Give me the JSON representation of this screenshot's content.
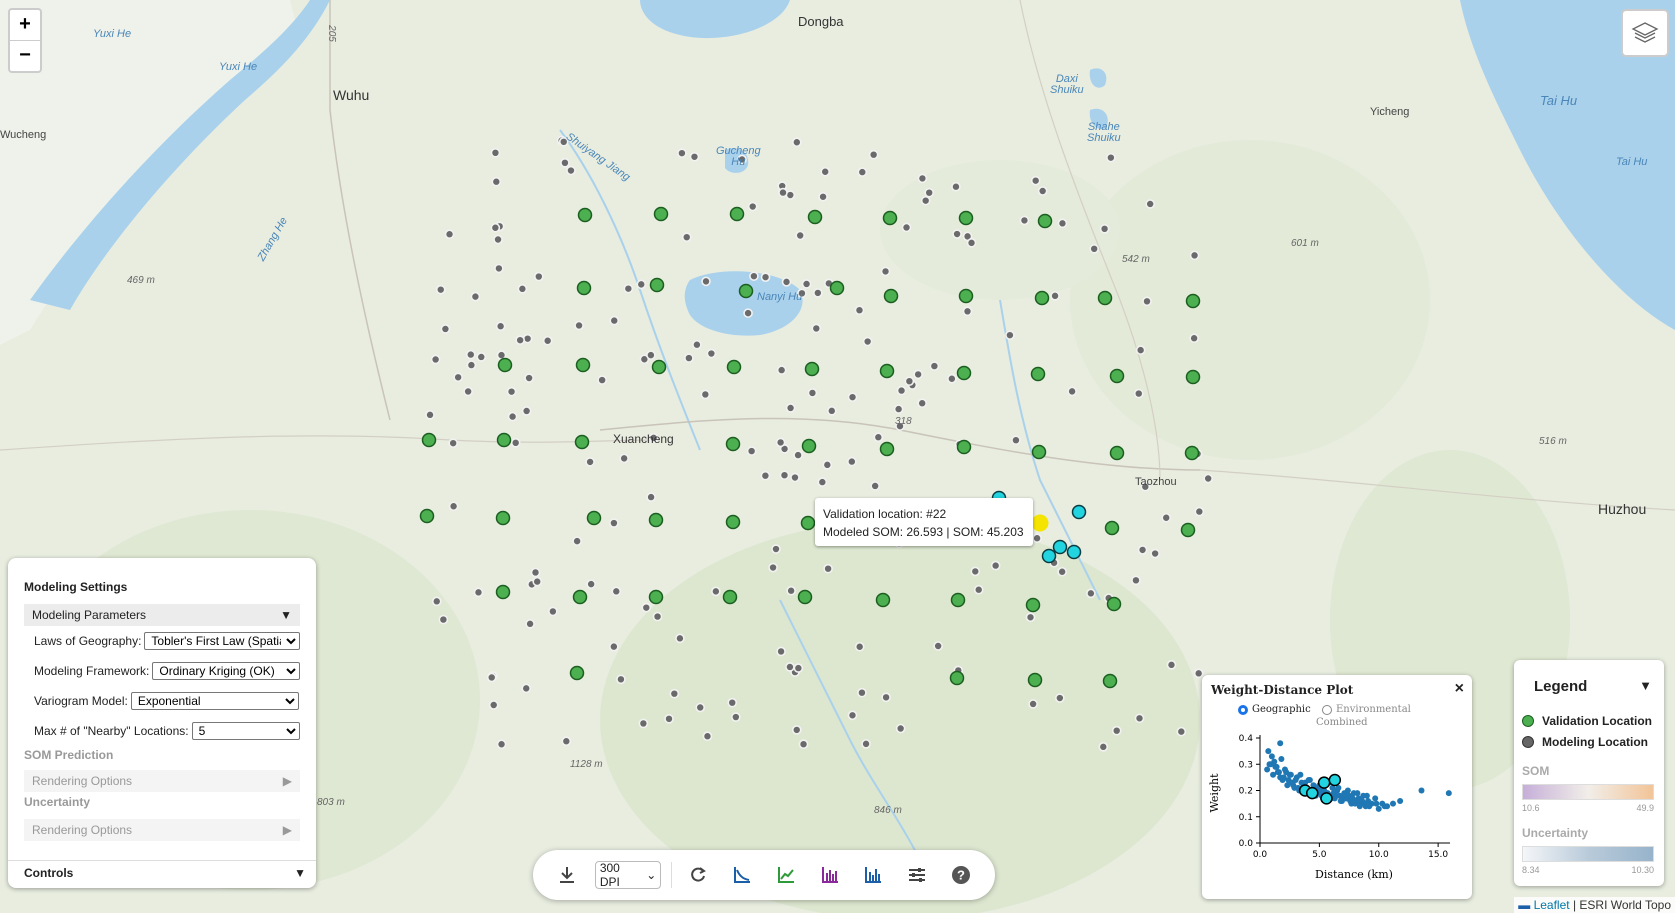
{
  "zoom": {
    "in_label": "+",
    "out_label": "−"
  },
  "map_labels": {
    "dongba": "Dongba",
    "wuhu": "Wuhu",
    "wucheng": "Wucheng",
    "yuxi_he_1": "Yuxi He",
    "yuxi_he_2": "Yuxi He",
    "zhang_he": "Zhang He",
    "shuiyang_jiang": "Shuiyang Jiang",
    "gucheng_hu": "Gucheng\nHu",
    "daxi_shuiku": "Daxi\nShuiku",
    "shahe_shuiku": "Shahe\nShuiku",
    "yicheng": "Yicheng",
    "tai_hu_1": "Tai Hu",
    "tai_hu_2": "Tai Hu",
    "nanyi_hu": "Nanyi Hu",
    "xuancheng": "Xuancheng",
    "taozhou": "Taozhou",
    "huzhou": "Huzhou",
    "e469": "469 m",
    "e542": "542 m",
    "e601": "601 m",
    "e516": "516 m",
    "e1128": "1128 m",
    "e803": "803 m",
    "e846": "846 m",
    "r205": "205",
    "r318": "318"
  },
  "settings": {
    "title": "Modeling Settings",
    "params_header": "Modeling Parameters",
    "laws_label": "Laws of Geography:",
    "laws_value": "Tobler's First Law (Spatia",
    "framework_label": "Modeling Framework:",
    "framework_value": "Ordinary Kriging (OK)",
    "variogram_label": "Variogram Model:",
    "variogram_value": "Exponential",
    "nearby_label": "Max # of \"Nearby\" Locations:",
    "nearby_value": "5",
    "som_prediction": "SOM Prediction",
    "rendering_1": "Rendering Options",
    "uncertainty": "Uncertainty",
    "rendering_2": "Rendering Options",
    "controls": "Controls",
    "expanded_icon": "▼",
    "collapsed_icon": "▶"
  },
  "tooltip": {
    "line1": "Validation location: #22",
    "line2": "Modeled SOM: 26.593 | SOM: 45.203"
  },
  "toolbar": {
    "dpi": "300 DPI",
    "icons": [
      "download-icon",
      "refresh-icon",
      "curve-icon",
      "trend-line-icon",
      "histogram-icon",
      "bar-chart-icon",
      "sliders-icon",
      "help-icon"
    ]
  },
  "weight_plot": {
    "title": "Weight-Distance Plot",
    "close": "×",
    "opt_geo": "Geographic",
    "opt_env": "Environmental",
    "opt_comb": "Combined",
    "ylabel": "Weight",
    "xlabel": "Distance (km)",
    "xticks": [
      "0.0",
      "5.0",
      "10.0",
      "15.0"
    ],
    "yticks": [
      "0.0",
      "0.1",
      "0.2",
      "0.3",
      "0.4"
    ]
  },
  "chart_data": {
    "type": "scatter",
    "title": "Weight-Distance Plot",
    "xlabel": "Distance (km)",
    "ylabel": "Weight",
    "xlim": [
      0,
      16
    ],
    "ylim": [
      0,
      0.4
    ],
    "series": [
      {
        "name": "all",
        "x": [
          0.6,
          0.8,
          1.0,
          1.1,
          1.3,
          1.5,
          1.7,
          1.9,
          2.1,
          2.3,
          2.5,
          2.7,
          2.9,
          3.1,
          3.3,
          3.5,
          3.7,
          3.9,
          4.1,
          4.3,
          4.5,
          4.7,
          4.9,
          5.1,
          5.3,
          5.5,
          5.7,
          5.9,
          6.1,
          6.3,
          6.5,
          6.7,
          6.9,
          7.1,
          7.3,
          7.5,
          7.7,
          7.9,
          8.1,
          8.3,
          8.5,
          8.7,
          8.9,
          9.1,
          9.4,
          9.7,
          10.0,
          10.3,
          10.7,
          11.2,
          11.8,
          1.2,
          1.6,
          2.0,
          2.4,
          2.8,
          3.2,
          3.6,
          4.0,
          4.4,
          4.8,
          5.2,
          5.6,
          6.0,
          6.4,
          6.8,
          7.2,
          7.6,
          8.0,
          8.4,
          8.8,
          9.2,
          0.9,
          1.4,
          2.2,
          3.0,
          3.8,
          4.6,
          5.4,
          6.2,
          7.0,
          7.8,
          8.6,
          1.7,
          13.6,
          15.9,
          0.7,
          1.8,
          2.6,
          3.4,
          4.2,
          5.0,
          5.8,
          6.6,
          7.4,
          8.2,
          9.0,
          9.8,
          10.5
        ],
        "y": [
          0.28,
          0.3,
          0.33,
          0.26,
          0.29,
          0.27,
          0.25,
          0.24,
          0.28,
          0.22,
          0.26,
          0.23,
          0.21,
          0.25,
          0.2,
          0.23,
          0.22,
          0.19,
          0.24,
          0.2,
          0.22,
          0.18,
          0.21,
          0.2,
          0.17,
          0.22,
          0.19,
          0.18,
          0.21,
          0.17,
          0.2,
          0.18,
          0.16,
          0.19,
          0.17,
          0.18,
          0.15,
          0.19,
          0.16,
          0.17,
          0.15,
          0.18,
          0.14,
          0.16,
          0.15,
          0.17,
          0.13,
          0.15,
          0.14,
          0.15,
          0.16,
          0.31,
          0.27,
          0.25,
          0.24,
          0.22,
          0.21,
          0.21,
          0.2,
          0.19,
          0.19,
          0.18,
          0.19,
          0.17,
          0.18,
          0.16,
          0.17,
          0.16,
          0.15,
          0.14,
          0.15,
          0.14,
          0.3,
          0.29,
          0.27,
          0.24,
          0.23,
          0.21,
          0.2,
          0.19,
          0.18,
          0.17,
          0.16,
          0.38,
          0.2,
          0.19,
          0.35,
          0.32,
          0.26,
          0.26,
          0.24,
          0.22,
          0.23,
          0.21,
          0.2,
          0.19,
          0.18,
          0.15,
          0.14
        ]
      },
      {
        "name": "nearby",
        "x": [
          3.8,
          4.4,
          5.4,
          6.3,
          5.6
        ],
        "y": [
          0.2,
          0.19,
          0.23,
          0.24,
          0.17
        ]
      }
    ]
  },
  "legend": {
    "title": "Legend",
    "collapse_icon": "▼",
    "validation": "Validation Location",
    "modeling": "Modeling Location",
    "som": "SOM",
    "som_min": "10.6",
    "som_max": "49.9",
    "uncertainty": "Uncertainty",
    "unc_min": "8.34",
    "unc_max": "10.30",
    "colors": {
      "validation": "#4caf50",
      "modeling": "#666666"
    }
  },
  "attribution": {
    "leaflet": "Leaflet",
    "rest": "| ESRI World Topo"
  },
  "colors": {
    "validation": "#4caf50",
    "modeling": "#6a6a6a",
    "highlight": "#22d3e0",
    "selected": "#f5e400",
    "scatter": "#1f77b4"
  }
}
